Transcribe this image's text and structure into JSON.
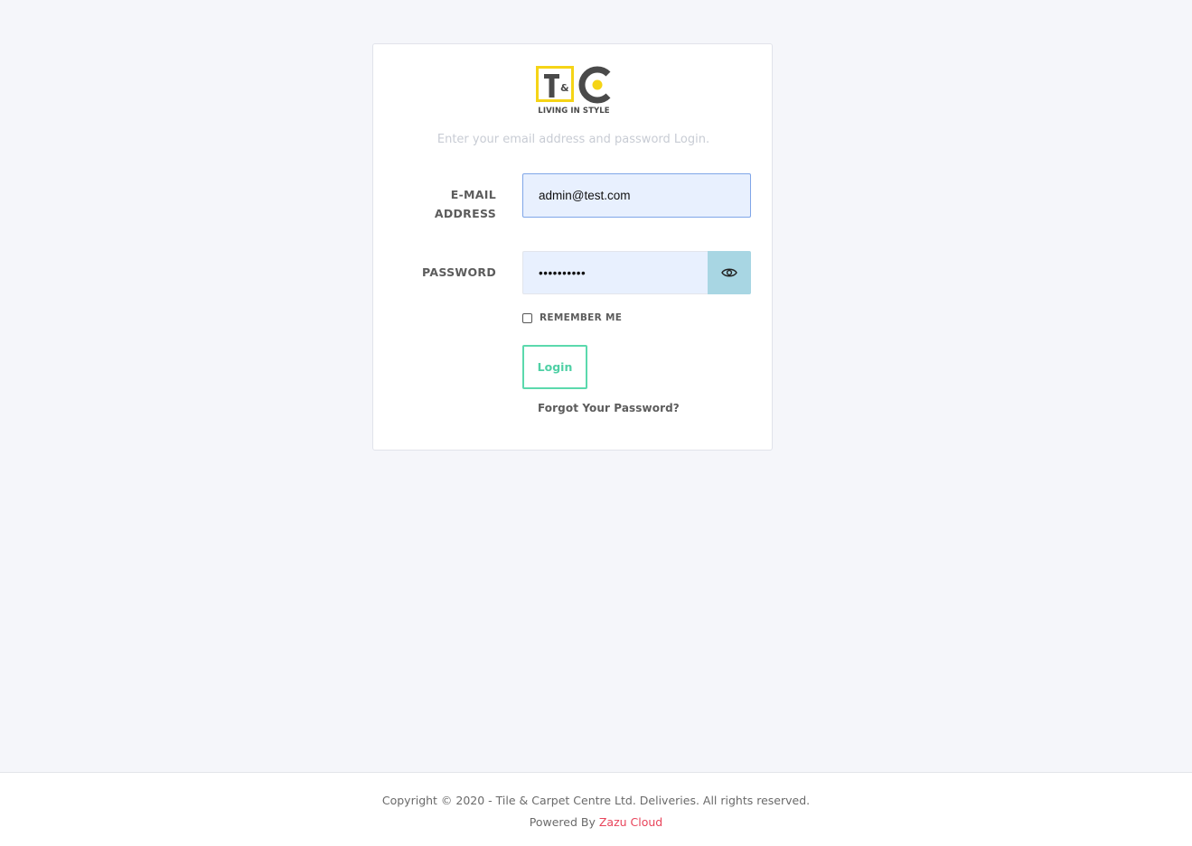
{
  "logo": {
    "tagline": "LIVING IN STYLE",
    "colors": {
      "frame": "#f5d416",
      "letters": "#4a4a4a",
      "dot": "#f5d416"
    }
  },
  "login": {
    "subtitle": "Enter your email address and password Login.",
    "email_label_line1": "E-MAIL",
    "email_label_line2": "ADDRESS",
    "email_value": "admin@test.com",
    "password_label": "PASSWORD",
    "password_value": "••••••••••",
    "toggle_icon": "eye-icon",
    "remember_label": "REMEMBER ME",
    "login_label": "Login",
    "forgot_label": "Forgot Your Password?"
  },
  "footer": {
    "copyright": "Copyright © 2020 - Tile & Carpet Centre Ltd. Deliveries. All rights reserved.",
    "powered_prefix": "Powered By ",
    "powered_link": "Zazu Cloud"
  },
  "colors": {
    "background": "#f5f6fa",
    "accent_green": "#5bd9ad",
    "input_fill": "#e8f0fe",
    "eye_button": "#a8d6e3",
    "link_red": "#e8435a"
  }
}
